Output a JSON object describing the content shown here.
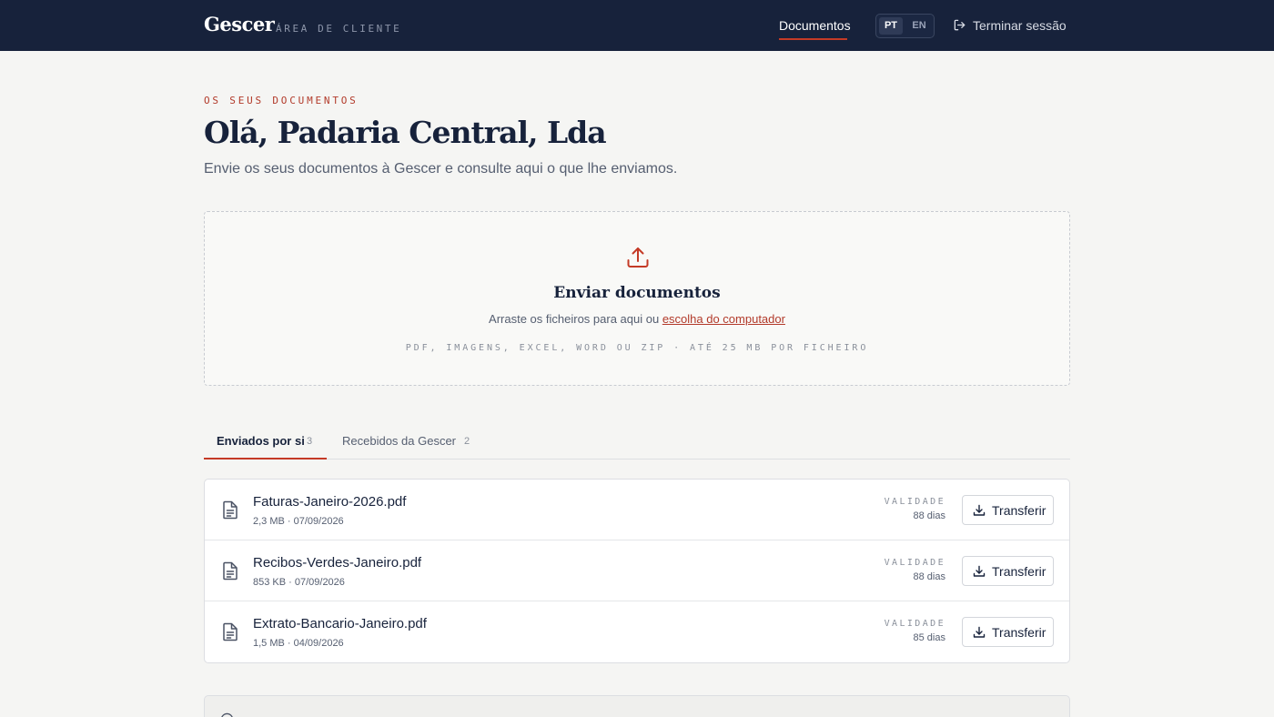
{
  "header": {
    "brand": "Gescer",
    "brand_sub": "ÁREA DE CLIENTE",
    "nav_documents": "Documentos",
    "lang_pt": "PT",
    "lang_en": "EN",
    "logout": "Terminar sessão",
    "logout_icon": "logout-icon"
  },
  "intro": {
    "eyebrow": "OS SEUS DOCUMENTOS",
    "title": "Olá, Padaria Central, Lda",
    "subtitle": "Envie os seus documentos à Gescer e consulte aqui o que lhe enviamos."
  },
  "upload": {
    "icon": "upload-icon",
    "title": "Enviar documentos",
    "line_prefix": "Arraste os ficheiros para aqui ou ",
    "link": "escolha do computador",
    "note": "PDF, IMAGENS, EXCEL, WORD OU ZIP · ATÉ 25 MB POR FICHEIRO"
  },
  "tabs": [
    {
      "label": "Enviados por si",
      "count": "3",
      "active": true
    },
    {
      "label": "Recebidos da Gescer",
      "count": "2",
      "active": false
    }
  ],
  "files": [
    {
      "name": "Faturas-Janeiro-2026.pdf",
      "meta": "2,3 MB · 07/09/2026",
      "validity_label": "VALIDADE",
      "validity": "88 dias",
      "action": "Transferir"
    },
    {
      "name": "Recibos-Verdes-Janeiro.pdf",
      "meta": "853 KB · 07/09/2026",
      "validity_label": "VALIDADE",
      "validity": "88 dias",
      "action": "Transferir"
    },
    {
      "name": "Extrato-Bancario-Janeiro.pdf",
      "meta": "1,5 MB · 04/09/2026",
      "validity_label": "VALIDADE",
      "validity": "85 dias",
      "action": "Transferir"
    }
  ],
  "colors": {
    "header_bg": "#17223b",
    "accent": "#c43a26",
    "page_bg": "#f5f5f3"
  }
}
